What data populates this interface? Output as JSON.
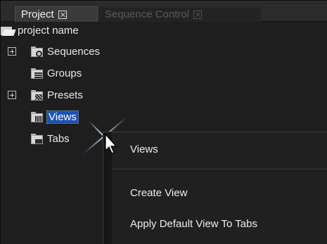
{
  "tabs": [
    {
      "label": "Project",
      "active": true
    },
    {
      "label": "Sequence Control",
      "active": false
    }
  ],
  "tree": {
    "root": {
      "label": "project name",
      "icon": "open-folder-icon"
    },
    "items": [
      {
        "label": "Sequences",
        "icon": "sequences-folder-icon",
        "expandable": true
      },
      {
        "label": "Groups",
        "icon": "groups-folder-icon",
        "expandable": false
      },
      {
        "label": "Presets",
        "icon": "presets-folder-icon",
        "expandable": true
      },
      {
        "label": "Views",
        "icon": "views-folder-icon",
        "expandable": false,
        "selected": true
      },
      {
        "label": "Tabs",
        "icon": "tabs-folder-icon",
        "expandable": false
      }
    ]
  },
  "context_menu": {
    "title": "Views",
    "items": [
      "Create View",
      "Apply Default View To Tabs"
    ]
  },
  "colors": {
    "background": "#1e1e1e",
    "selection": "#1c52b4",
    "text": "#e8e8e8",
    "inactive_tab_text": "#5a5a5a"
  }
}
